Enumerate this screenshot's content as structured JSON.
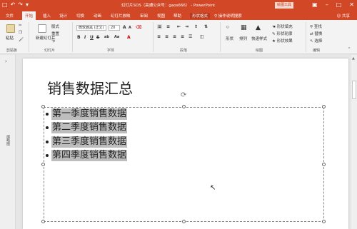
{
  "titlebar": {
    "title": "幻灯片SOS（高通公众号：gaos666） - PowerPoint",
    "tools_tab": "绘图工具",
    "qat_icons": [
      "save-icon",
      "undo-icon",
      "redo-icon",
      "customize-icon"
    ],
    "window_controls": [
      "restore-icon",
      "minimize-icon",
      "maximize-icon",
      "close-icon"
    ]
  },
  "menu": {
    "tabs": [
      {
        "label": "文件"
      },
      {
        "label": "开始"
      },
      {
        "label": "插入"
      },
      {
        "label": "设计"
      },
      {
        "label": "切换"
      },
      {
        "label": "动画"
      },
      {
        "label": "幻灯片放映"
      },
      {
        "label": "审阅"
      },
      {
        "label": "视图"
      },
      {
        "label": "帮助"
      },
      {
        "label": "形状格式"
      }
    ],
    "tell_me": "操作说明搜索",
    "user": "共享"
  },
  "ribbon": {
    "clipboard": {
      "paste": "粘贴",
      "cut": "剪切",
      "copy": "复制",
      "format_painter": "格式刷",
      "label": "剪贴板"
    },
    "slides": {
      "new_slide": "新建幻灯片",
      "layout": "版式",
      "reset": "重置",
      "section": "节",
      "label": "幻灯片"
    },
    "font": {
      "font_name": "微软雅黑 (正文)",
      "font_size": "20",
      "label": "字体"
    },
    "paragraph": {
      "label": "段落"
    },
    "drawing": {
      "shapes": "形状",
      "arrange": "排列",
      "quick_styles": "快速样式",
      "fill": "形状填充",
      "outline": "形状轮廓",
      "effects": "形状效果",
      "label": "绘图"
    },
    "editing": {
      "find": "查找",
      "replace": "替换",
      "select": "选择",
      "label": "编辑"
    }
  },
  "rail": {
    "label": "缩略图"
  },
  "slide": {
    "title": "销售数据汇总",
    "bullets": [
      "第一季度销售数据",
      "第二季度销售数据",
      "第三季度销售数据",
      "第四季度销售数据"
    ]
  },
  "colors": {
    "accent": "#d24726",
    "selection": "#bdbdbd"
  }
}
